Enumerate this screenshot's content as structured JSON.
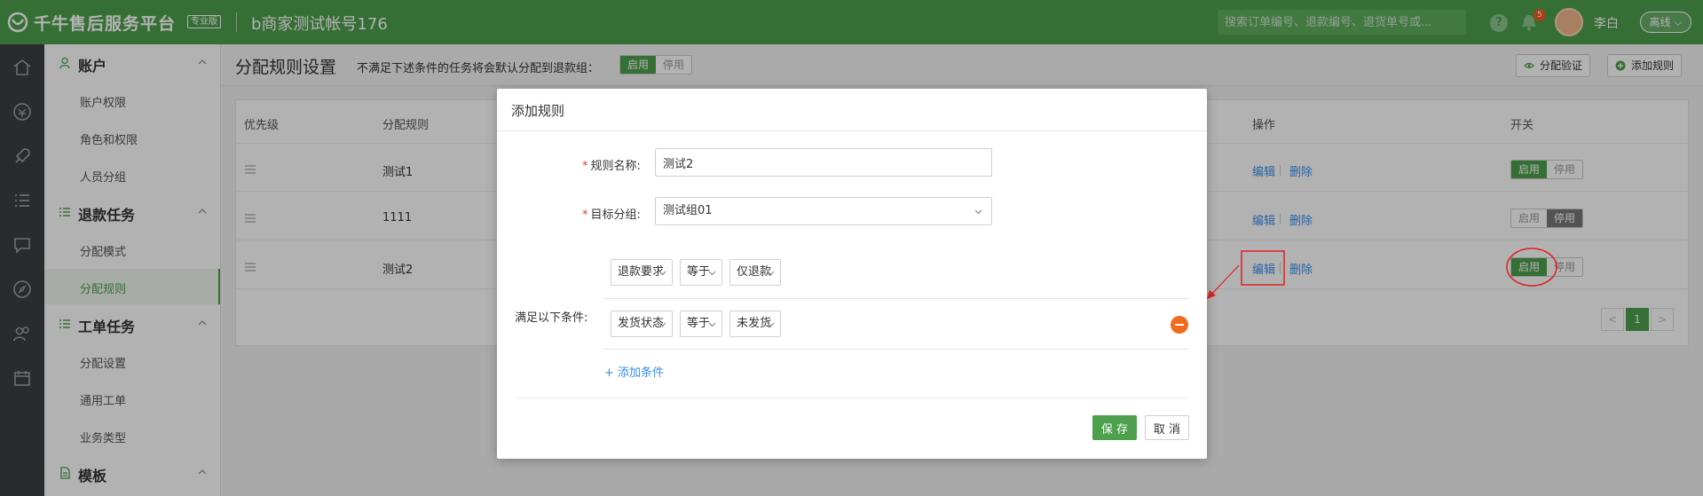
{
  "app": {
    "brand": "千牛售后服务平台",
    "edition": "专业版",
    "shop_name": "b商家测试帐号176",
    "search_placeholder": "搜索订单编号、退款编号、退货单号或...",
    "notification_count": "5",
    "user_name": "李白",
    "status_label": "离线",
    "accent_color": "#4ea04d"
  },
  "sidebar": {
    "sections": [
      {
        "title": "账户",
        "items": [
          "账户权限",
          "角色和权限",
          "人员分组"
        ]
      },
      {
        "title": "退款任务",
        "items": [
          "分配模式",
          "分配规则"
        ]
      },
      {
        "title": "工单任务",
        "items": [
          "分配设置",
          "通用工单",
          "业务类型"
        ]
      },
      {
        "title": "模板",
        "items": []
      }
    ],
    "active_item": "分配规则"
  },
  "page": {
    "title": "分配规则设置",
    "note": "不满足下述条件的任务将会默认分配到退款组：",
    "toggle_on": "启用",
    "toggle_off": "停用",
    "verify_button": "分配验证",
    "add_rule_button": "添加规则"
  },
  "table": {
    "headers": {
      "priority": "优先级",
      "rule": "分配规则",
      "ops": "操作",
      "switch": "开关"
    },
    "rows": [
      {
        "rule": "测试1",
        "edit": "编辑",
        "delete": "删除",
        "on": "启用",
        "off": "停用",
        "state": "on"
      },
      {
        "rule": "1111",
        "edit": "编辑",
        "delete": "删除",
        "on": "启用",
        "off": "停用",
        "state": "off"
      },
      {
        "rule": "测试2",
        "edit": "编辑",
        "delete": "删除",
        "on": "启用",
        "off": "停用",
        "state": "on"
      }
    ],
    "pagination": {
      "prev": "<",
      "current": "1",
      "next": ">"
    }
  },
  "modal": {
    "title": "添加规则",
    "name_label": "规则名称:",
    "name_value": "测试2",
    "group_label": "目标分组:",
    "group_value": "测试组01",
    "conditions_label": "满足以下条件:",
    "conditions": [
      {
        "field": "退款要求",
        "operator": "等于",
        "value": "仅退款",
        "removable": false
      },
      {
        "field": "发货状态",
        "operator": "等于",
        "value": "未发货",
        "removable": true
      }
    ],
    "add_condition": "添加条件",
    "save": "保 存",
    "cancel": "取 消"
  },
  "annotation_color": "#e02020"
}
